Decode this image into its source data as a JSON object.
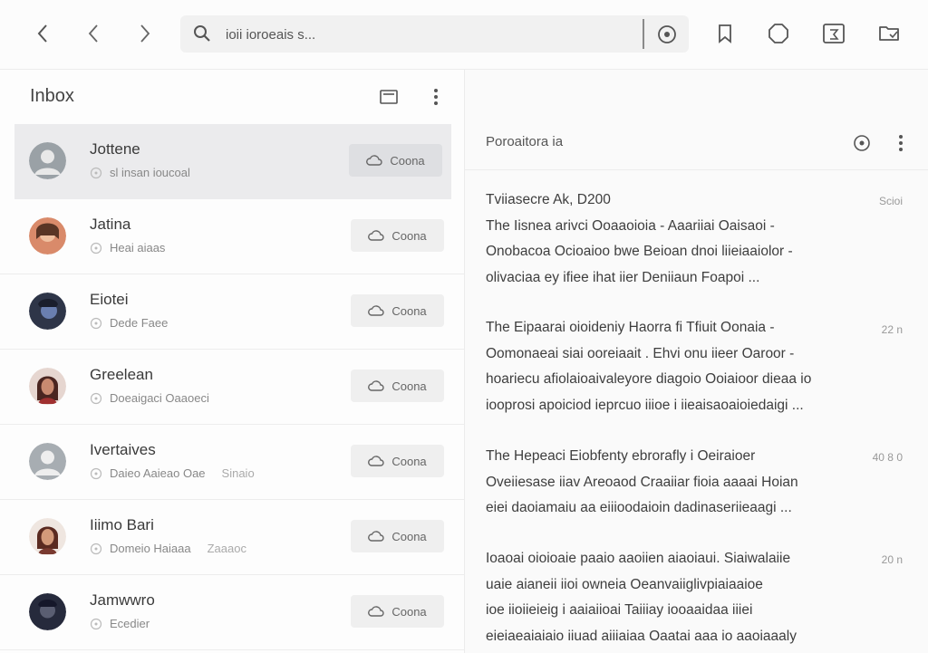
{
  "search": {
    "value": "ioii ioroeais s..."
  },
  "inbox": {
    "title": "Inbox",
    "messages": [
      {
        "sender": "Jottene",
        "meta": "sl insan ioucoal",
        "extra": "",
        "action": "Coona",
        "avatar_color": "#9aa1a6"
      },
      {
        "sender": "Jatina",
        "meta": "Heai aiaas",
        "extra": "",
        "action": "Coona",
        "avatar_color": "#c9825a"
      },
      {
        "sender": "Eiotei",
        "meta": "Dede Faee",
        "extra": "",
        "action": "Coona",
        "avatar_color": "#4a5570"
      },
      {
        "sender": "Greelean",
        "meta": "Doeaigaci Oaaoeci",
        "extra": "",
        "action": "Coona",
        "avatar_color": "#8a4a40"
      },
      {
        "sender": "Ivertaives",
        "meta": "Daieo Aaieao Oae",
        "extra": "Sinaio",
        "action": "Coona",
        "avatar_color": "#a7adb2"
      },
      {
        "sender": "Iiimo Bari",
        "meta": "Domeio Haiaaa",
        "extra": "Zaaaoc",
        "action": "Coona",
        "avatar_color": "#8a4a3a"
      },
      {
        "sender": "Jamwwro",
        "meta": "Ecedier",
        "extra": "",
        "action": "Coona",
        "avatar_color": "#3a3f55"
      }
    ]
  },
  "preview": {
    "title": "Poroaitora ia",
    "items": [
      {
        "time": "Scioi",
        "lines": [
          "Tviiasecre Ak, D200",
          "The Iisnea arivci Ooaaoioia - Aaariiai Oaisaoi -",
          "Onobacoa Ocioaioo bwe Beioan dnoi liieiaaiolor -",
          "olivaciaa ey ifiee ihat iier Deniiaun Foapoi ..."
        ]
      },
      {
        "time": "22 n",
        "lines": [
          "The Eipaarai oioideniy Haorra fi Tfiuit Oonaia -",
          "Oomonaeai siai ooreiaait . Ehvi onu iieer Oaroor -",
          "hoariecu afiolaioaivaleyore diagoio Ooiaioor dieaa io",
          "iooprosi apoiciod ieprcuo iiioe i iieaisaoaioiedaigi ..."
        ]
      },
      {
        "time": "40 8 0",
        "lines": [
          "The Hepeaci Eiobfenty ebrorafly i Oeiraioer",
          "Oveiiesase iiav Areoaod Craaiiar fioia aaaai Hoian",
          "eiei daoiamaiu aa eiiioodaioin dadinaseriieaagi ..."
        ]
      },
      {
        "time": "20 n",
        "lines": [
          "Ioaoai oioioaie paaio aaoiien aiaoiaui. Siaiwalaiie",
          "uaie aianeii iioi owneia Oeanvaiiglivpiaiaaioe",
          "ioe iioiieieig i aaiaiioai Taiiiay iooaaidaa iiiei",
          "eieiaeaiaiaio iiuad aiiiaiaa Oaatai aaa io aaoiaaaly"
        ]
      }
    ]
  }
}
